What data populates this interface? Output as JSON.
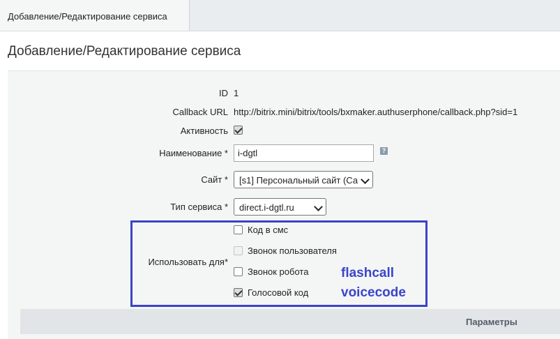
{
  "tab": {
    "label": "Добавление/Редактирование сервиса"
  },
  "page": {
    "title": "Добавление/Редактирование сервиса"
  },
  "form": {
    "id": {
      "label": "ID",
      "value": "1"
    },
    "callback": {
      "label": "Callback URL",
      "value": "http://bitrix.mini/bitrix/tools/bxmaker.authuserphone/callback.php?sid=1"
    },
    "active": {
      "label": "Активность",
      "checked": true
    },
    "name": {
      "label": "Наименование *",
      "value": "i-dgtl"
    },
    "site": {
      "label": "Сайт *",
      "value": "[s1] Персональный сайт (Са"
    },
    "service_type": {
      "label": "Тип сервиса *",
      "value": "direct.i-dgtl.ru"
    },
    "use_for": {
      "label": "Использовать для*",
      "options": [
        {
          "label": "Код в смс",
          "checked": false,
          "disabled": false
        },
        {
          "label": "Звонок пользователя",
          "checked": false,
          "disabled": true
        },
        {
          "label": "Звонок робота",
          "checked": false,
          "disabled": false
        },
        {
          "label": "Голосовой код",
          "checked": true,
          "disabled": false
        }
      ]
    }
  },
  "annotations": {
    "line1": "flashcall",
    "line2": "voicecode",
    "color": "#3a44c9"
  },
  "params": {
    "label": "Параметры"
  },
  "help_icon": {
    "glyph": "?"
  }
}
